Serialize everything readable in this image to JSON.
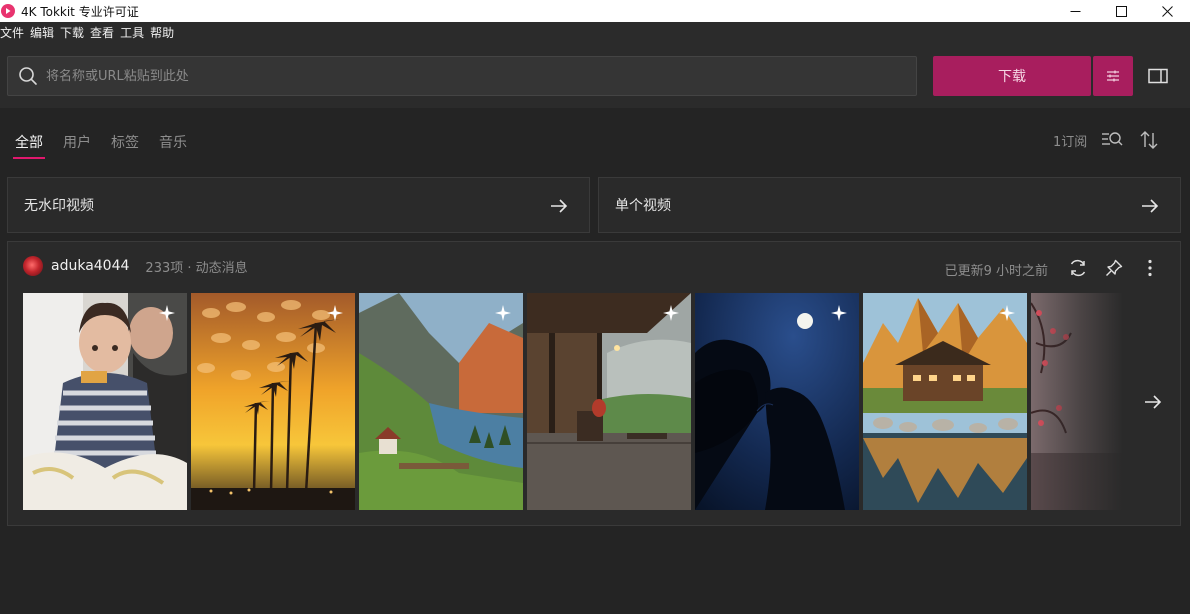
{
  "window": {
    "title": "4K Tokkit 专业许可证"
  },
  "menu": {
    "items": [
      "文件",
      "编辑",
      "下载",
      "查看",
      "工具",
      "帮助"
    ]
  },
  "search": {
    "placeholder": "将名称或URL粘贴到此处",
    "value": ""
  },
  "toolbar": {
    "download_label": "下载"
  },
  "tabs": [
    {
      "label": "全部",
      "active": true
    },
    {
      "label": "用户",
      "active": false
    },
    {
      "label": "标签",
      "active": false
    },
    {
      "label": "音乐",
      "active": false
    }
  ],
  "subscriptions": {
    "label": "1订阅"
  },
  "categories": [
    {
      "label": "无水印视频"
    },
    {
      "label": "单个视频"
    }
  ],
  "feed": {
    "username": "aduka4044",
    "meta": "233项 · 动态消息",
    "updated": "已更新9 小时之前",
    "thumbnails": [
      {
        "icon": "sparkle-icon"
      },
      {
        "icon": "sparkle-icon"
      },
      {
        "icon": "sparkle-icon"
      },
      {
        "icon": "sparkle-icon"
      },
      {
        "icon": "sparkle-icon"
      },
      {
        "icon": "sparkle-icon"
      },
      {
        "icon": ""
      }
    ]
  },
  "colors": {
    "accent": "#a81e5e",
    "tab_indicator": "#e0186d",
    "background": "#242424",
    "card": "#2a2a2a",
    "muted_text": "#8d8d8d"
  },
  "icons": {
    "app": "tokkit-logo-icon",
    "search": "search-icon",
    "settings": "sliders-icon",
    "panel": "sidebar-panel-icon",
    "list_search": "list-search-icon",
    "sort": "sort-icon",
    "arrow": "arrow-right-icon",
    "refresh": "refresh-icon",
    "pin": "pin-icon",
    "more": "more-vertical-icon"
  }
}
